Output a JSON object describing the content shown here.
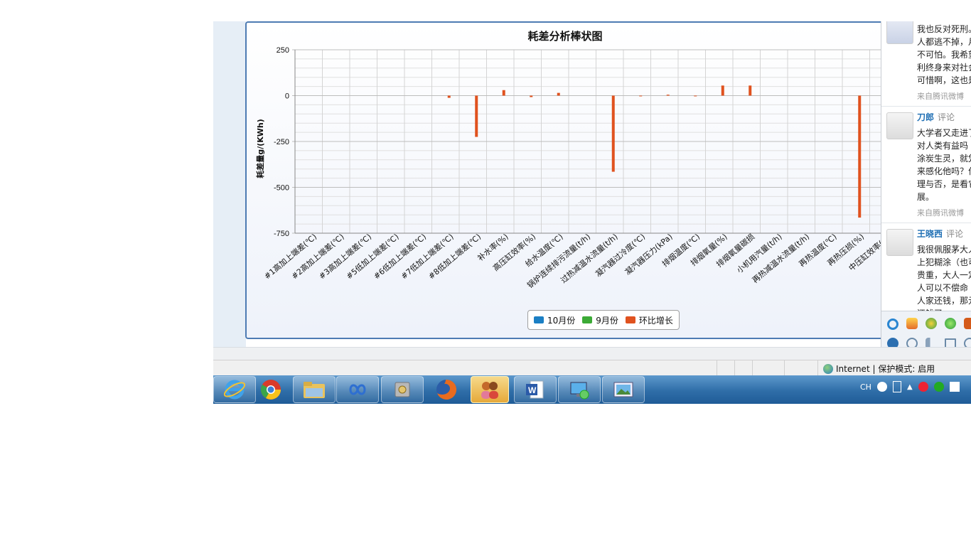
{
  "chart_data": {
    "type": "bar",
    "title": "耗差分析棒状图",
    "ylabel": "耗差量g/(KWh)",
    "ylim": [
      -750,
      250
    ],
    "yticks": [
      250,
      0,
      -250,
      -500,
      -750
    ],
    "categories": [
      "#1高加上端差(℃)",
      "#2高加上端差(℃)",
      "#3高加上端差(℃)",
      "#5低加上端差(℃)",
      "#6低加上端差(℃)",
      "#7低加上端差(℃)",
      "#8低加上端差(℃)",
      "补水率(%)",
      "高压缸效率(%)",
      "给水温度(℃)",
      "锅炉连续排污流量(t/h)",
      "过热减温水流量(t/h)",
      "凝汽器过冷度(℃)",
      "凝汽器压力(kPa)",
      "排烟温度(℃)",
      "排烟氧量(%)",
      "排烟氧量碳损",
      "小机用汽量(t/h)",
      "再热减温水流量(t/h)",
      "再热温度(℃)",
      "再热压损(%)",
      "中压缸效率(%)"
    ],
    "series": [
      {
        "name": "10月份",
        "color": "#1b7fc4",
        "values": [
          0,
          0,
          0,
          0,
          0,
          0,
          0,
          0,
          0,
          0,
          0,
          0,
          0,
          0,
          0,
          0,
          0,
          0,
          0,
          0,
          0,
          0
        ]
      },
      {
        "name": "9月份",
        "color": "#3caa36",
        "values": [
          0,
          0,
          0,
          0,
          0,
          0,
          0,
          0,
          0,
          0,
          0,
          0,
          0,
          0,
          0,
          0,
          0,
          0,
          0,
          0,
          0,
          0
        ]
      },
      {
        "name": "环比增长",
        "color": "#e0521f",
        "values": [
          0,
          0,
          0,
          0,
          0,
          -12,
          -225,
          30,
          -8,
          15,
          0,
          -415,
          -3,
          5,
          -2,
          55,
          55,
          0,
          0,
          0,
          -665,
          0
        ]
      }
    ],
    "legend": "bottom-center",
    "grid": true
  },
  "status": {
    "zone_text": "Internet | 保护模式: 启用"
  },
  "tray": {
    "lang": "CH"
  },
  "comments": [
    {
      "name": "",
      "action": "",
      "lines": [
        "我也反对死刑。",
        "人都逃不掉，月",
        "不可怕。我希望",
        "利终身来对社会",
        "可惜啊，这也是"
      ],
      "source": "来自腾讯微博"
    },
    {
      "name": "刀郎",
      "action": "评论",
      "lines": [
        "大学者又走进了",
        "对人类有益吗",
        "涂炭生灵，就凭",
        "来感化他吗？作",
        "理与否，是看它",
        "展。"
      ],
      "source": "来自腾讯微博"
    },
    {
      "name": "王晓西",
      "action": "评论",
      "lines": [
        "我很佩服茅大人",
        "上犯糊涂（也可",
        "贵重，大人一定",
        "人可以不偿命",
        "人家还钱，那元",
        "还钱了"
      ],
      "source": ""
    }
  ],
  "taskbar": {
    "apps": [
      "internet-explorer",
      "chrome",
      "file-explorer",
      "infinity-app",
      "safe-app",
      "firefox",
      "contacts-app",
      "word",
      "remote-desktop",
      "photo-viewer"
    ]
  }
}
